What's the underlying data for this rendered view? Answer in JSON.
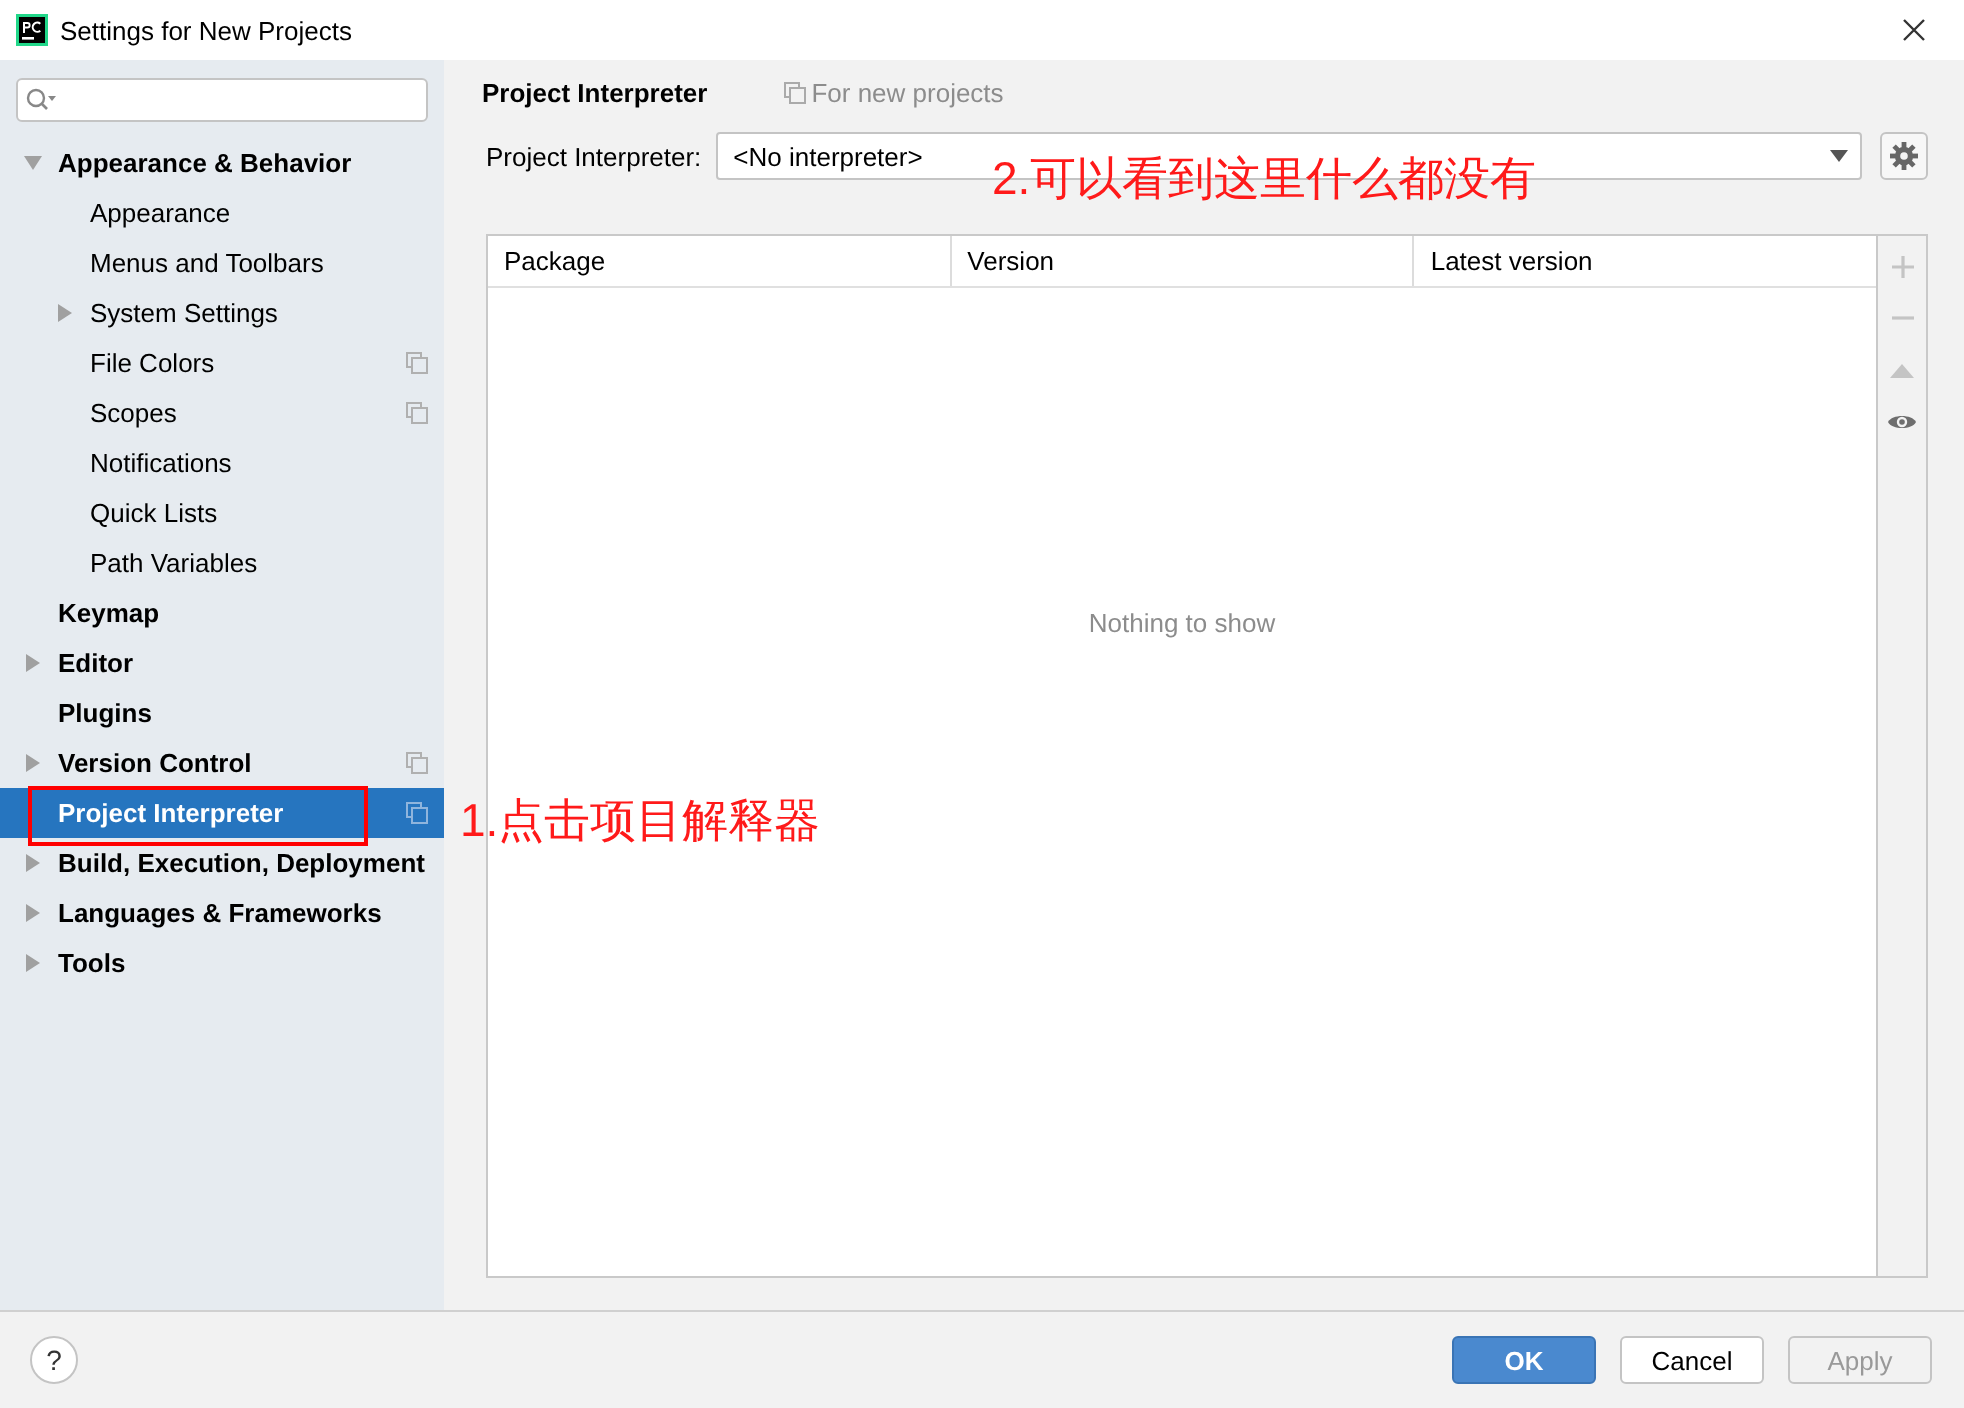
{
  "window": {
    "title": "Settings for New Projects"
  },
  "sidebar": {
    "items": [
      {
        "label": "Appearance & Behavior",
        "kind": "folder",
        "expanded": true,
        "selected": false,
        "project_level": false,
        "children": [
          {
            "label": "Appearance",
            "kind": "page",
            "selected": false,
            "project_level": false
          },
          {
            "label": "Menus and Toolbars",
            "kind": "page",
            "selected": false,
            "project_level": false
          },
          {
            "label": "System Settings",
            "kind": "folder",
            "expanded": false,
            "selected": false,
            "project_level": false
          },
          {
            "label": "File Colors",
            "kind": "page",
            "selected": false,
            "project_level": true
          },
          {
            "label": "Scopes",
            "kind": "page",
            "selected": false,
            "project_level": true
          },
          {
            "label": "Notifications",
            "kind": "page",
            "selected": false,
            "project_level": false
          },
          {
            "label": "Quick Lists",
            "kind": "page",
            "selected": false,
            "project_level": false
          },
          {
            "label": "Path Variables",
            "kind": "page",
            "selected": false,
            "project_level": false
          }
        ]
      },
      {
        "label": "Keymap",
        "kind": "page",
        "selected": false,
        "project_level": false
      },
      {
        "label": "Editor",
        "kind": "folder",
        "expanded": false,
        "selected": false,
        "project_level": false
      },
      {
        "label": "Plugins",
        "kind": "page",
        "selected": false,
        "project_level": false
      },
      {
        "label": "Version Control",
        "kind": "folder",
        "expanded": false,
        "selected": false,
        "project_level": true
      },
      {
        "label": "Project Interpreter",
        "kind": "page",
        "selected": true,
        "project_level": true
      },
      {
        "label": "Build, Execution, Deployment",
        "kind": "folder",
        "expanded": false,
        "selected": false,
        "project_level": false
      },
      {
        "label": "Languages & Frameworks",
        "kind": "folder",
        "expanded": false,
        "selected": false,
        "project_level": false
      },
      {
        "label": "Tools",
        "kind": "folder",
        "expanded": false,
        "selected": false,
        "project_level": false
      }
    ]
  },
  "content": {
    "title": "Project Interpreter",
    "scope_note": "For new projects",
    "interpreter": {
      "label": "Project Interpreter:",
      "value": "<No interpreter>"
    },
    "table": {
      "columns": [
        "Package",
        "Version",
        "Latest version"
      ],
      "empty_text": "Nothing to show"
    },
    "toolbar": [
      {
        "kind": "plus",
        "disabled": true
      },
      {
        "kind": "minus",
        "disabled": true
      },
      {
        "kind": "up",
        "disabled": true
      },
      {
        "kind": "eye",
        "disabled": false
      }
    ]
  },
  "annotations": [
    {
      "text": "1.点击项目解释器"
    },
    {
      "text": "2.可以看到这里什么都没有"
    }
  ],
  "help": {
    "label": "?"
  },
  "buttons": [
    {
      "label": "OK",
      "kind": "primary",
      "disabled": false
    },
    {
      "label": "Cancel",
      "kind": "normal",
      "disabled": false
    },
    {
      "label": "Apply",
      "kind": "normal",
      "disabled": true
    }
  ]
}
